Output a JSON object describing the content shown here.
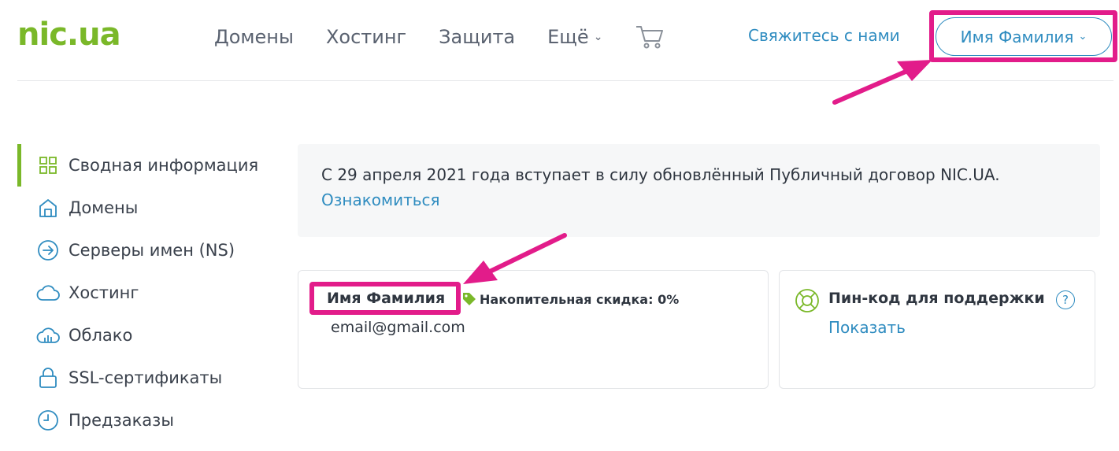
{
  "header": {
    "logo": "nic.ua",
    "nav": [
      {
        "label": "Домены"
      },
      {
        "label": "Хостинг"
      },
      {
        "label": "Защита"
      },
      {
        "label": "Ещё"
      }
    ],
    "contact_label": "Свяжитесь с нами",
    "user_label": "Имя Фамилия"
  },
  "sidebar": {
    "items": [
      {
        "label": "Сводная информация",
        "icon": "grid-icon",
        "active": true
      },
      {
        "label": "Домены",
        "icon": "home-icon"
      },
      {
        "label": "Серверы имен (NS)",
        "icon": "arrow-circle-icon"
      },
      {
        "label": "Хостинг",
        "icon": "cloud-icon"
      },
      {
        "label": "Облако",
        "icon": "cloud-chart-icon"
      },
      {
        "label": "SSL-сертификаты",
        "icon": "lock-icon"
      },
      {
        "label": "Предзаказы",
        "icon": "clock-icon"
      }
    ]
  },
  "notice": {
    "text": "С 29 апреля 2021 года вступает в силу обновлённый Публичный договор NIC.UA.",
    "link": "Ознакомиться"
  },
  "account_card": {
    "name": "Имя Фамилия",
    "discount": "Накопительная скидка: 0%",
    "email": "email@gmail.com"
  },
  "pin_card": {
    "title": "Пин-код для поддержки",
    "help": "?",
    "show_link": "Показать"
  },
  "colors": {
    "brand_green": "#7ab829",
    "link_blue": "#2f8cc0",
    "highlight_pink": "#e21c8a"
  }
}
